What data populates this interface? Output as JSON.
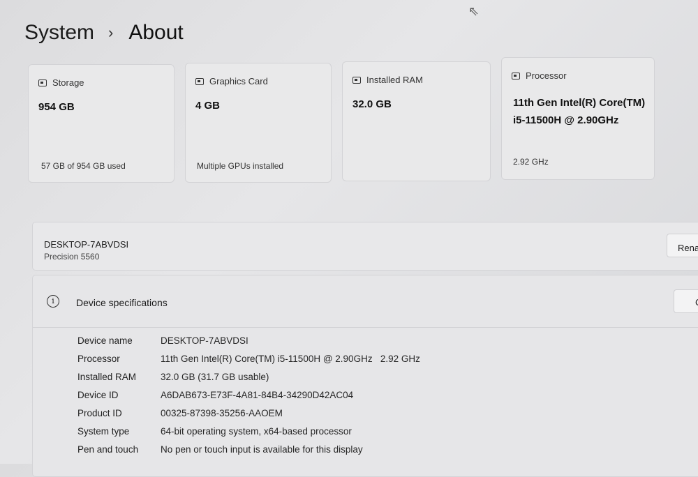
{
  "breadcrumb": {
    "parent": "System",
    "separator": "›",
    "current": "About"
  },
  "cards": {
    "storage": {
      "title": "Storage",
      "value": "954 GB",
      "detail": "57 GB of 954 GB used"
    },
    "graphics": {
      "title": "Graphics Card",
      "value": "4 GB",
      "detail": "Multiple GPUs installed"
    },
    "ram": {
      "title": "Installed RAM",
      "value": "32.0 GB"
    },
    "processor": {
      "title": "Processor",
      "value": "11th Gen Intel(R) Core(TM) i5-11500H @ 2.90GHz",
      "detail": "2.92 GHz"
    }
  },
  "device": {
    "name": "DESKTOP-7ABVDSI",
    "model": "Precision 5560",
    "rename_label": "Rena"
  },
  "specs": {
    "title": "Device specifications",
    "copy_label": "C",
    "rows": [
      {
        "label": "Device name",
        "value": "DESKTOP-7ABVDSI"
      },
      {
        "label": "Processor",
        "value": "11th Gen Intel(R) Core(TM) i5-11500H @ 2.90GHz   2.92 GHz"
      },
      {
        "label": "Installed RAM",
        "value": "32.0 GB (31.7 GB usable)"
      },
      {
        "label": "Device ID",
        "value": "A6DAB673-E73F-4A81-84B4-34290D42AC04"
      },
      {
        "label": "Product ID",
        "value": "00325-87398-35256-AAOEM"
      },
      {
        "label": "System type",
        "value": "64-bit operating system, x64-based processor"
      },
      {
        "label": "Pen and touch",
        "value": "No pen or touch input is available for this display"
      }
    ]
  }
}
